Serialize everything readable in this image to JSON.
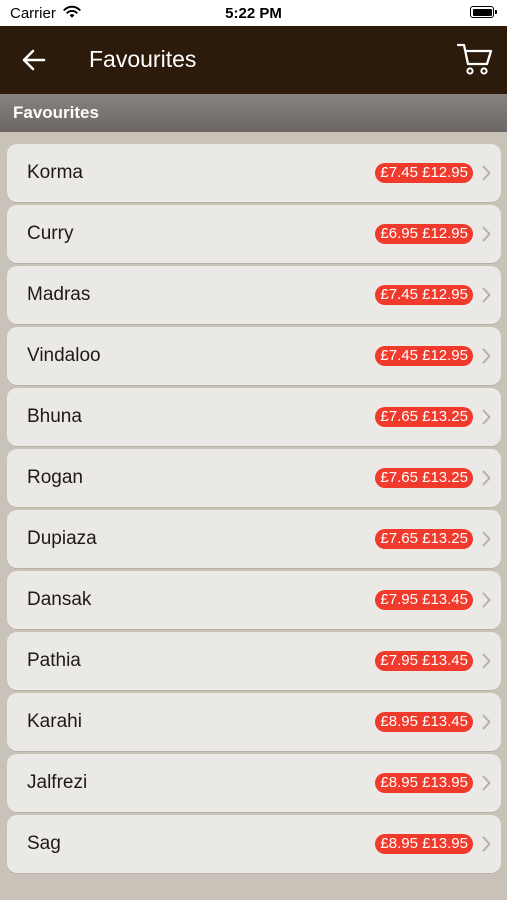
{
  "status_bar": {
    "carrier": "Carrier",
    "time": "5:22 PM",
    "icons": [
      "wifi-icon",
      "battery-icon"
    ]
  },
  "nav_bar": {
    "title": "Favourites",
    "background": "#2c1a0b",
    "left_icon": "back-arrow-icon",
    "right_icon": "cart-icon"
  },
  "section": {
    "label": "Favourites"
  },
  "colors": {
    "price_badge": "#ef3a2c",
    "row_background": "#ebe9e6",
    "page_background": "#c9c2b8"
  },
  "items": [
    {
      "name": "Korma",
      "price": "£7.45 £12.95"
    },
    {
      "name": "Curry",
      "price": "£6.95 £12.95"
    },
    {
      "name": "Madras",
      "price": "£7.45 £12.95"
    },
    {
      "name": "Vindaloo",
      "price": "£7.45 £12.95"
    },
    {
      "name": "Bhuna",
      "price": "£7.65 £13.25"
    },
    {
      "name": "Rogan",
      "price": "£7.65 £13.25"
    },
    {
      "name": "Dupiaza",
      "price": "£7.65 £13.25"
    },
    {
      "name": "Dansak",
      "price": "£7.95 £13.45"
    },
    {
      "name": "Pathia",
      "price": "£7.95 £13.45"
    },
    {
      "name": "Karahi",
      "price": "£8.95 £13.45"
    },
    {
      "name": "Jalfrezi",
      "price": "£8.95 £13.95"
    },
    {
      "name": "Sag",
      "price": "£8.95 £13.95"
    }
  ]
}
